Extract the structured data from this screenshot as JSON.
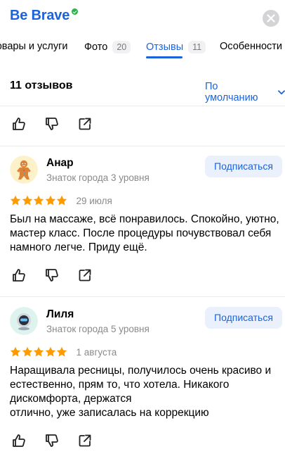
{
  "header": {
    "title": "Be Brave",
    "close_icon": "close-icon"
  },
  "tabs": [
    {
      "label": "Товары и услуги"
    },
    {
      "label": "Фото",
      "badge": "20"
    },
    {
      "label": "Отзывы",
      "badge": "11",
      "active": true
    },
    {
      "label": "Особенности"
    }
  ],
  "reviews_header": {
    "count": "11 отзывов",
    "sort": "По умолчанию"
  },
  "reviews": [
    {
      "name": "Анар",
      "level": "Знаток города 3 уровня",
      "subscribe": "Подписаться",
      "rating": 5,
      "date": "29 июля",
      "text": "Был на массаже, всё понравилось. Спокойно, уютно, мастер класс. После процедуры почувствовал себя намного легче. Приду ещё.",
      "avatar_icon": "gingerbread-avatar-icon"
    },
    {
      "name": "Лиля",
      "level": "Знаток города 5 уровня",
      "subscribe": "Подписаться",
      "rating": 5,
      "date": "1 августа",
      "text": "Наращивала ресницы, получилось очень красиво и естественно, прям то, что хотела. Никакого дискомфорта, держатся\nотлично, уже записалась на коррекцию",
      "avatar_icon": "robot-avatar-icon"
    }
  ],
  "colors": {
    "accent": "#1a63db",
    "star": "#fc9c00",
    "muted": "#8a8a8a",
    "subscribe_bg": "#eaf1fd"
  }
}
